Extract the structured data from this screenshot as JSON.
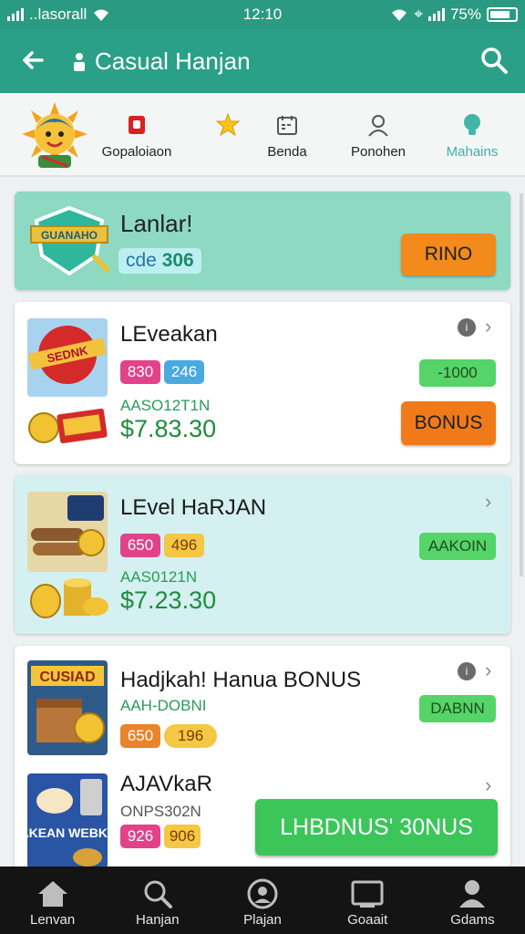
{
  "status_bar": {
    "carrier": "..lasorall",
    "time": "12:10",
    "battery": "75%"
  },
  "app_bar": {
    "title": "Casual Hanjan"
  },
  "categories": [
    {
      "label": "Gopaloiaon",
      "icon": "red-badge-icon"
    },
    {
      "label": "Benda",
      "icon": "calendar-icon"
    },
    {
      "label": "Ponohen",
      "icon": "person-icon"
    },
    {
      "label": "Mahains",
      "icon": "bulb-icon"
    }
  ],
  "hero_card": {
    "title": "Lanlar!",
    "code_prefix": "cde",
    "code_value": "306",
    "button": "RINO",
    "badge_text": "GUANAHO"
  },
  "cards": [
    {
      "title": "LEveakan",
      "pill1": "830",
      "pill2": "246",
      "sub": "AASO12T1N",
      "price": "$7.83.30",
      "tag": "-1000",
      "button": "BONUS",
      "badge_text": "SEDNK"
    },
    {
      "title": "LEvel HaRJAN",
      "pill1": "650",
      "pill2": "496",
      "sub": "AAS0121N",
      "price": "$7.23.30",
      "tag": "AAKOIN",
      "badge_text": ""
    },
    {
      "title": "Hadjkah! Hanua BONUS",
      "sub": "AAH-DOBNI",
      "pill1": "650",
      "pill2": "196",
      "tag": "DABNN",
      "badge_text": "CUSIAD"
    },
    {
      "title": "AJAVkaR",
      "sub": "ONPS302N",
      "pill1": "926",
      "pill2": "906",
      "badge_text": "BAKEAN WEBKES"
    }
  ],
  "sticky_button": "LHBDNUS' 30NUS",
  "bottom_nav": [
    {
      "label": "Lenvan",
      "icon": "home-icon"
    },
    {
      "label": "Hanjan",
      "icon": "search-icon"
    },
    {
      "label": "Plajan",
      "icon": "game-icon"
    },
    {
      "label": "Goaait",
      "icon": "tv-icon"
    },
    {
      "label": "Gdams",
      "icon": "profile-icon"
    }
  ]
}
